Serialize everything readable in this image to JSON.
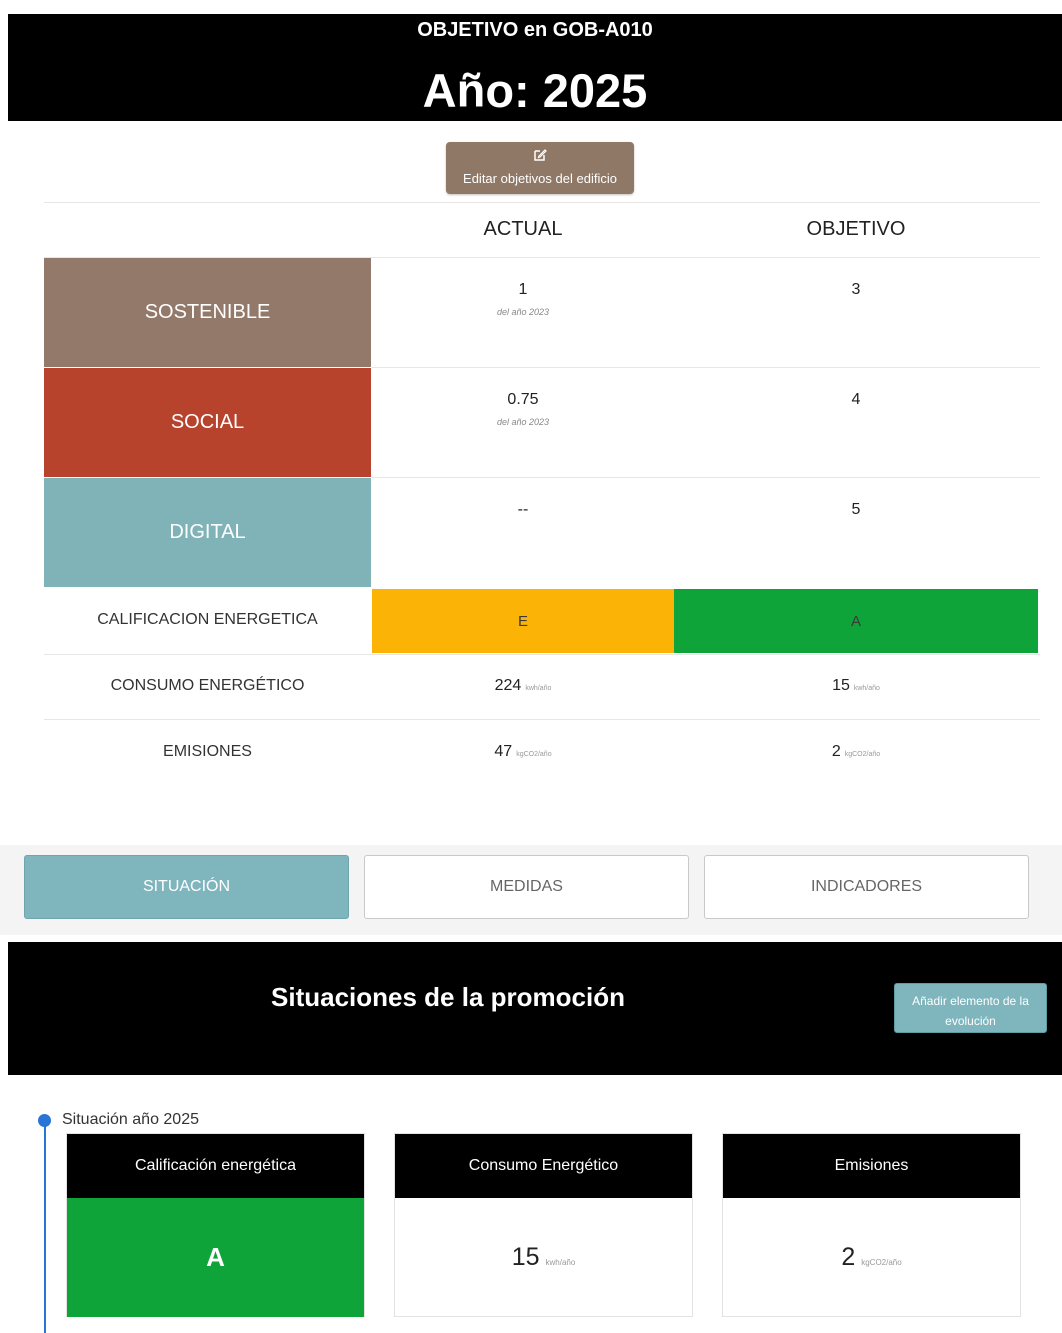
{
  "header": {
    "subtitle": "OBJETIVO en GOB-A010",
    "title": "Año: 2025"
  },
  "edit_button": {
    "icon": "edit-icon",
    "label": "Editar objetivos del edificio"
  },
  "table": {
    "col_actual": "ACTUAL",
    "col_objetivo": "OBJETIVO",
    "categories": [
      {
        "label": "SOSTENIBLE",
        "color": "#93796a",
        "actual": "1",
        "actual_note": "del año 2023",
        "objetivo": "3"
      },
      {
        "label": "SOCIAL",
        "color": "#b8432c",
        "actual": "0.75",
        "actual_note": "del año 2023",
        "objetivo": "4"
      },
      {
        "label": "DIGITAL",
        "color": "#7fb3b8",
        "actual": "--",
        "actual_note": "",
        "objetivo": "5"
      }
    ],
    "calificacion": {
      "label": "CALIFICACION ENERGETICA",
      "actual": "E",
      "actual_color": "#fbb405",
      "objetivo": "A",
      "objetivo_color": "#0ea43a"
    },
    "consumo": {
      "label": "CONSUMO ENERGÉTICO",
      "actual": "224",
      "objetivo": "15",
      "unit": "kwh/año"
    },
    "emisiones": {
      "label": "EMISIONES",
      "actual": "47",
      "objetivo": "2",
      "unit": "kgCO2/año"
    }
  },
  "tabs": [
    {
      "label": "SITUACIÓN",
      "active": true
    },
    {
      "label": "MEDIDAS",
      "active": false
    },
    {
      "label": "INDICADORES",
      "active": false
    }
  ],
  "situaciones": {
    "title": "Situaciones de la promoción",
    "add_button": "Añadir elemento de la evolución",
    "timeline_label": "Situación año 2025",
    "cards": [
      {
        "title": "Calificación energética",
        "value": "A",
        "unit": ""
      },
      {
        "title": "Consumo Energético",
        "value": "15",
        "unit": "kwh/año"
      },
      {
        "title": "Emisiones",
        "value": "2",
        "unit": "kgCO2/año"
      }
    ]
  }
}
